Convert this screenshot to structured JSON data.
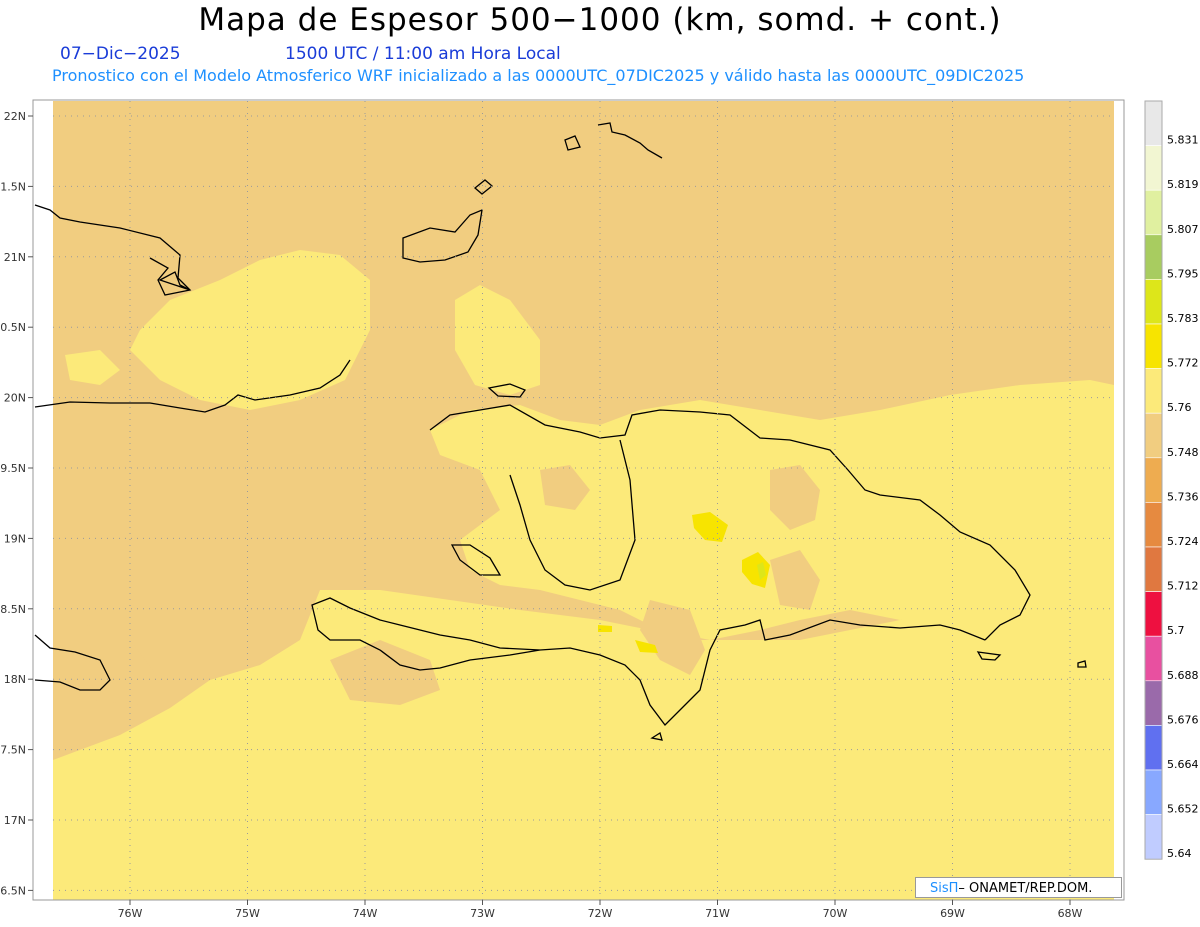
{
  "header": {
    "title": "Mapa de Espesor 500−1000 (km, somd. + cont.)",
    "date": "07−Dic−2025",
    "time": "1500 UTC / 11:00 am Hora Local",
    "description": "Pronostico con el Modelo Atmosferico WRF inicializado a las 0000UTC_07DIC2025 y válido hasta las  0000UTC_09DIC2025"
  },
  "map": {
    "lat_labels": [
      "22N",
      "1.5N",
      "21N",
      "0.5N",
      "20N",
      "9.5N",
      "19N",
      "8.5N",
      "18N",
      "7.5N",
      "17N",
      "6.5N"
    ],
    "lon_labels": [
      "76W",
      "75W",
      "74W",
      "73W",
      "72W",
      "71W",
      "70W",
      "69W",
      "68W"
    ]
  },
  "legend": {
    "labels": [
      "5.831",
      "5.819",
      "5.807",
      "5.795",
      "5.783",
      "5.772",
      "5.76",
      "5.748",
      "5.736",
      "5.724",
      "5.712",
      "5.7",
      "5.688",
      "5.676",
      "5.664",
      "5.652",
      "5.64"
    ],
    "colors": [
      "#e8e8e8",
      "#f2f6d2",
      "#e0f0a0",
      "#a8cc60",
      "#dde61a",
      "#f7e400",
      "#fcea7a",
      "#f1cd80",
      "#eeac50",
      "#e68a40",
      "#e07840",
      "#ee1040",
      "#e850a0",
      "#9a6aaa",
      "#6070f0",
      "#88a8ff",
      "#c0ccff"
    ]
  },
  "credit": {
    "brand": "SisΠ",
    "org": "– ONAMET/REP.DOM."
  }
}
